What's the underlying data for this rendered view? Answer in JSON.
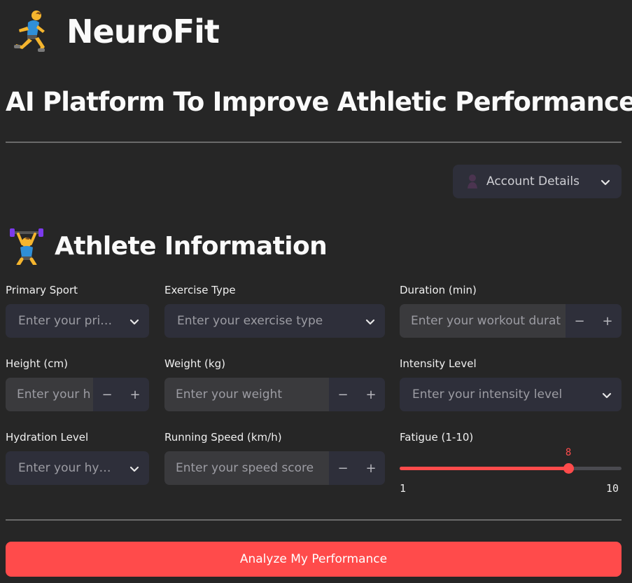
{
  "app": {
    "title": "NeuroFit",
    "subtitle": "AI Platform To Improve Athletic Performance",
    "brand_icon": "running-person-icon"
  },
  "account": {
    "label": "Account Details",
    "icon": "person-silhouette-icon"
  },
  "section": {
    "title": "Athlete Information",
    "icon": "weightlifter-icon"
  },
  "fields": {
    "primary_sport": {
      "label": "Primary Sport",
      "placeholder": "Enter your pri…"
    },
    "exercise_type": {
      "label": "Exercise Type",
      "placeholder": "Enter your exercise type"
    },
    "duration": {
      "label": "Duration (min)",
      "placeholder": "Enter your workout durat"
    },
    "height": {
      "label": "Height (cm)",
      "placeholder": "Enter your h"
    },
    "weight": {
      "label": "Weight (kg)",
      "placeholder": "Enter your weight"
    },
    "intensity": {
      "label": "Intensity Level",
      "placeholder": "Enter your intensity level"
    },
    "hydration": {
      "label": "Hydration Level",
      "placeholder": "Enter your hy…"
    },
    "running_speed": {
      "label": "Running Speed (km/h)",
      "placeholder": "Enter your speed score"
    },
    "fatigue": {
      "label": "Fatigue (1-10)",
      "value": "8",
      "min": "1",
      "max": "10"
    }
  },
  "stepper": {
    "minus": "−",
    "plus": "+"
  },
  "actions": {
    "analyze": "Analyze My Performance"
  },
  "colors": {
    "accent": "#ff4b4b",
    "background": "#262626",
    "input": "#2e2f3a"
  }
}
